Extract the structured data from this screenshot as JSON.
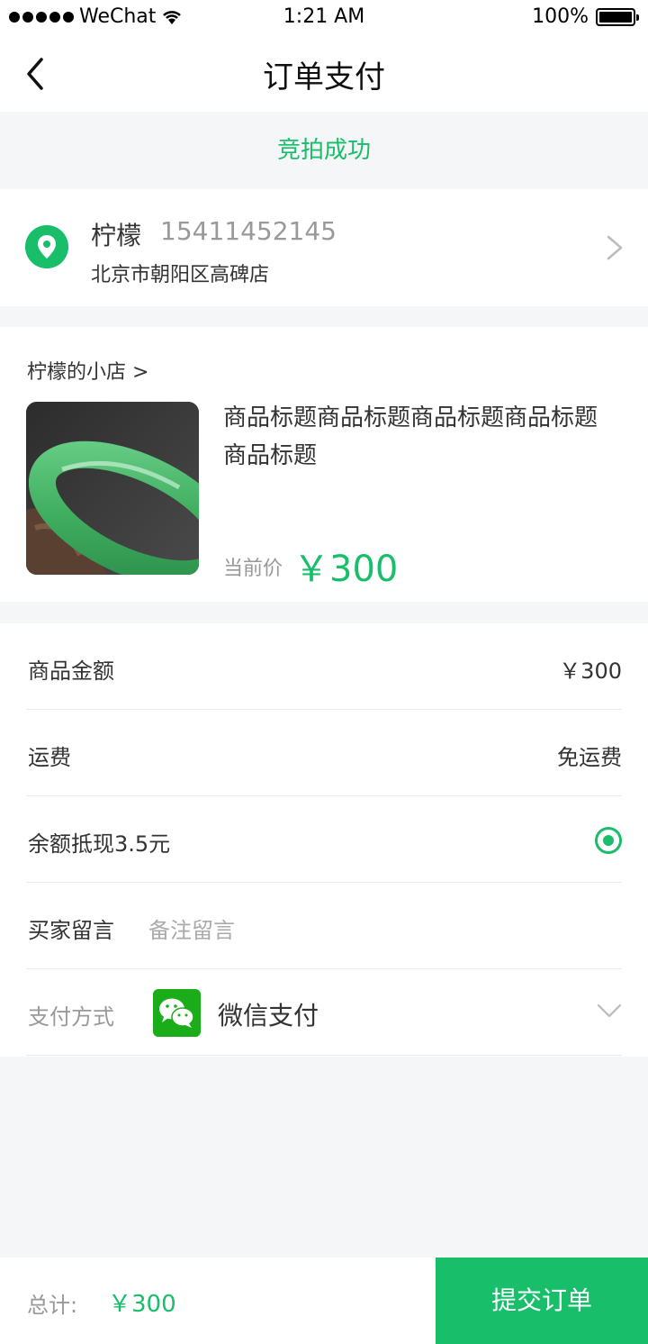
{
  "status_bar": {
    "carrier": "WeChat",
    "time": "1:21 AM",
    "battery": "100%"
  },
  "nav": {
    "title": "订单支付"
  },
  "banner": {
    "text": "竞拍成功"
  },
  "address": {
    "name": "柠檬",
    "phone": "15411452145",
    "line": "北京市朝阳区高碑店"
  },
  "product": {
    "shop": "柠檬的小店 >",
    "title": "商品标题商品标题商品标题商品标题商品标题",
    "price_label": "当前价",
    "price": "￥300"
  },
  "details": {
    "amount_label": "商品金额",
    "amount_value": "￥300",
    "shipping_label": "运费",
    "shipping_value": "免运费",
    "balance_label": "余额抵现3.5元",
    "remark_label": "买家留言",
    "remark_placeholder": "备注留言",
    "pay_label": "支付方式",
    "pay_method": "微信支付"
  },
  "footer": {
    "total_label": "总计:",
    "total_value": "￥300",
    "submit": "提交订单"
  },
  "colors": {
    "accent": "#19be6b",
    "wechat": "#1aad19"
  }
}
